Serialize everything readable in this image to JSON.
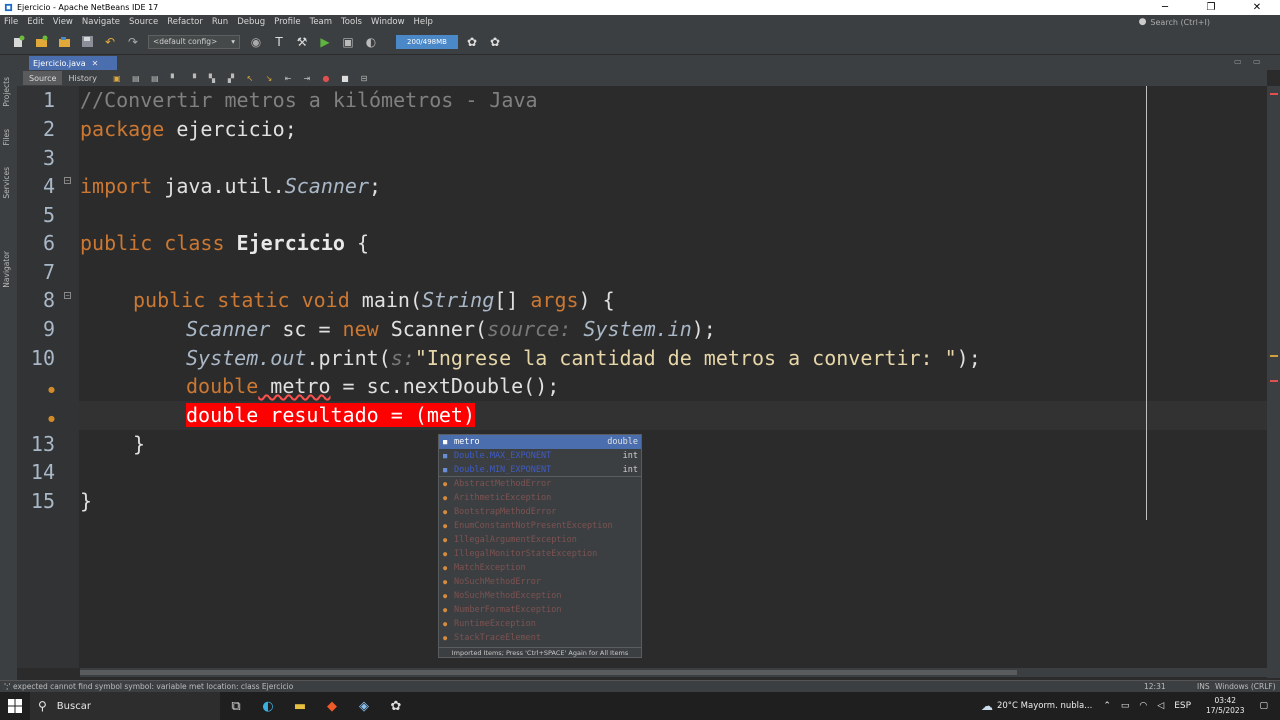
{
  "window": {
    "title": "Ejercicio - Apache NetBeans IDE 17",
    "minimize": "─",
    "maximize": "❐",
    "close": "✕"
  },
  "menu": [
    "File",
    "Edit",
    "View",
    "Navigate",
    "Source",
    "Refactor",
    "Run",
    "Debug",
    "Profile",
    "Team",
    "Tools",
    "Window",
    "Help"
  ],
  "search": {
    "placeholder": "Search (Ctrl+I)"
  },
  "toolbar": {
    "config": "<default config>",
    "memory": "200/498MB"
  },
  "sidebar": {
    "tabs": [
      "Projects",
      "Files",
      "Services",
      "Navigator"
    ]
  },
  "editor": {
    "tab": "Ejercicio.java",
    "source_label": "Source",
    "history_label": "History",
    "line_numbers": [
      "1",
      "2",
      "3",
      "4",
      "5",
      "6",
      "7",
      "8",
      "9",
      "10",
      "",
      "",
      "13",
      "14",
      "15"
    ]
  },
  "code": {
    "l1": "//Convertir metros a kilómetros - Java",
    "l2_kw": "package",
    "l2_rest": " ejercicio;",
    "l4_kw": "import",
    "l4_pkg": " java.util.",
    "l4_cls": "Scanner",
    "l4_end": ";",
    "l6_kw": "public class ",
    "l6_name": "Ejercicio",
    "l6_end": " {",
    "l8_kw": "public static void ",
    "l8_m": "main(",
    "l8_type": "String",
    "l8_arr": "[] ",
    "l8_arg": "args",
    "l8_end": ") {",
    "l9_t": "Scanner",
    "l9_v": " sc = ",
    "l9_new": "new",
    "l9_c": " Scanner(",
    "l9_hint": "source: ",
    "l9_sys": "System",
    "l9_in": ".in",
    "l9_end": ");",
    "l10_sys": "System",
    "l10_out": ".out",
    "l10_m": ".print(",
    "l10_hint": "s:",
    "l10_str": "\"Ingrese la cantidad de metros a convertir: \"",
    "l10_end": ");",
    "l11_kw": "double",
    "l11_v": " metro",
    "l11_rest": " = sc.nextDouble();",
    "l12": "double resultado = (met)",
    "l13": "}",
    "l15": "}"
  },
  "completion": {
    "items": [
      {
        "name": "metro",
        "type": "double"
      },
      {
        "name": "Double.MAX_EXPONENT",
        "type": "int"
      },
      {
        "name": "Double.MIN_EXPONENT",
        "type": "int"
      },
      {
        "name": "AbstractMethodError",
        "type": ""
      },
      {
        "name": "ArithmeticException",
        "type": ""
      },
      {
        "name": "BootstrapMethodError",
        "type": ""
      },
      {
        "name": "EnumConstantNotPresentException",
        "type": ""
      },
      {
        "name": "IllegalArgumentException",
        "type": ""
      },
      {
        "name": "IllegalMonitorStateException",
        "type": ""
      },
      {
        "name": "MatchException",
        "type": ""
      },
      {
        "name": "NoSuchMethodError",
        "type": ""
      },
      {
        "name": "NoSuchMethodException",
        "type": ""
      },
      {
        "name": "NumberFormatException",
        "type": ""
      },
      {
        "name": "RuntimeException",
        "type": ""
      },
      {
        "name": "StackTraceElement",
        "type": ""
      }
    ],
    "footer": "Imported Items; Press 'Ctrl+SPACE' Again for All Items"
  },
  "status": {
    "message": "';' expected  cannot find symbol   symbol:  variable met  location: class Ejercicio",
    "position": "12:31",
    "mode": "INS",
    "encoding": "Windows (CRLF)"
  },
  "taskbar": {
    "search": "Buscar",
    "weather": "20°C  Mayorm. nubla...",
    "lang": "ESP",
    "time": "03:42",
    "date": "17/5/2023"
  }
}
